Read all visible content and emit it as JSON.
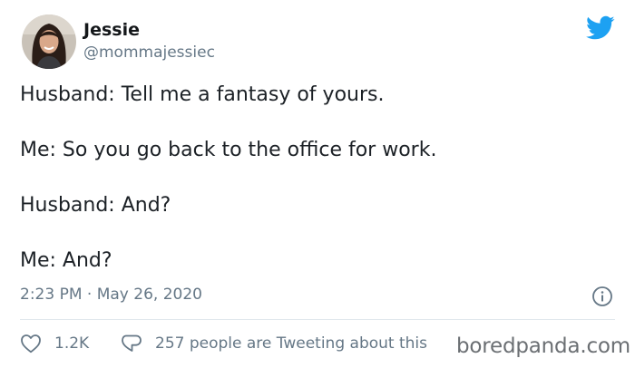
{
  "author": {
    "name": "Jessie",
    "handle": "@mommajessiec"
  },
  "tweet": {
    "lines": [
      "Husband: Tell me a fantasy of yours.",
      "Me: So you go back to the office for work.",
      "Husband: And?",
      "Me: And?"
    ],
    "timestamp": "2:23 PM · May 26, 2020"
  },
  "actions": {
    "likes": "1.2K",
    "discussion": "257 people are Tweeting about this"
  },
  "watermark": "boredpanda.com",
  "colors": {
    "twitter_blue": "#1da1f2",
    "secondary_text": "#657786",
    "divider": "#e1e8ed"
  },
  "icons": {
    "brand": "twitter-bird-icon",
    "info": "info-icon",
    "like": "heart-icon",
    "reply": "speech-bubble-icon"
  }
}
